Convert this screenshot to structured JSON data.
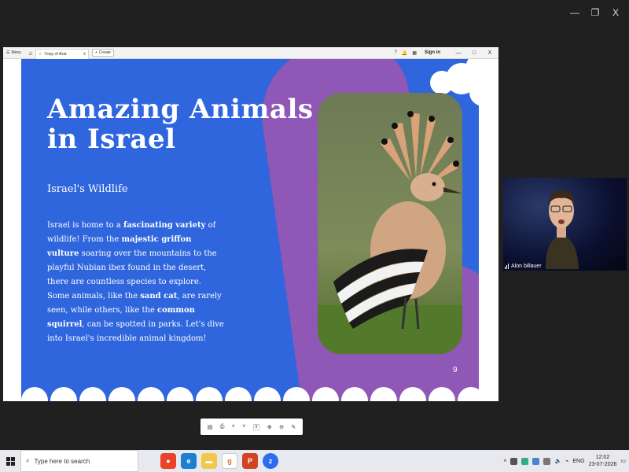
{
  "window_controls": {
    "minimize": "—",
    "restore": "❐",
    "close": "X"
  },
  "browser": {
    "menu_label": "Menu",
    "tab_title": "Copy of Asia",
    "tab_close": "x",
    "create_label": "Create",
    "sign_in": "Sign in",
    "min": "—",
    "max": "□",
    "close": "X"
  },
  "slide": {
    "title_line1": "Amazing Animals",
    "title_line2": "in Israel",
    "subtitle": "Israel's Wildlife",
    "body": [
      {
        "text": "Israel is home to a ",
        "bold": false
      },
      {
        "text": "fascinating variety",
        "bold": true
      },
      {
        "text": " of wildlife! From the ",
        "bold": false
      },
      {
        "text": "majestic griffon vulture",
        "bold": true
      },
      {
        "text": " soaring over the mountains to the playful Nubian ibex found in the desert, there are countless species to explore. Some animals, like the ",
        "bold": false
      },
      {
        "text": "sand cat",
        "bold": true
      },
      {
        "text": ", are rarely seen, while others, like the ",
        "bold": false
      },
      {
        "text": "common squirrel",
        "bold": true
      },
      {
        "text": ", can be spotted in parks. Let's dive into Israel's incredible animal kingdom!",
        "bold": false
      }
    ],
    "page_number": "9",
    "background_color": "#2f66dd",
    "accent_color": "#8f57b6"
  },
  "presenter_toolbar": {
    "page": "9"
  },
  "video": {
    "participant_name": "Alon billauer"
  },
  "taskbar": {
    "search_placeholder": "Type here to search",
    "language": "ENG",
    "time": "12:02",
    "date": "23-07-2026"
  }
}
